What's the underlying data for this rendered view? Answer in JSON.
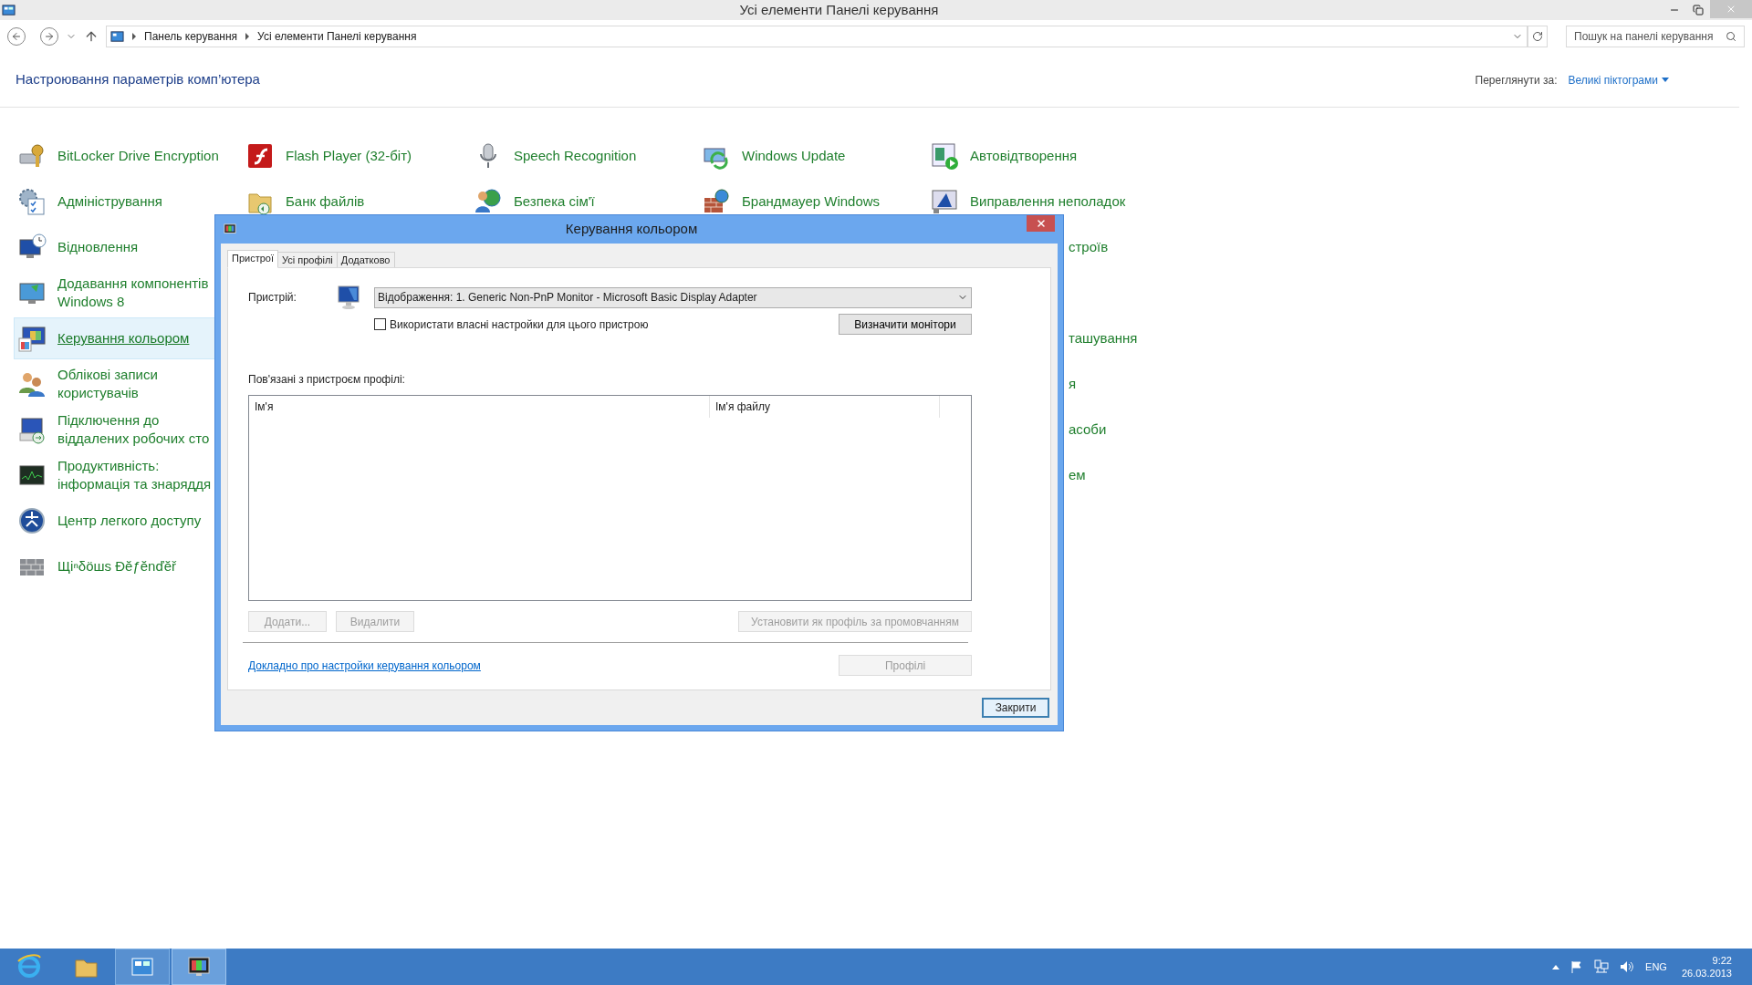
{
  "window": {
    "title": "Усі елементи Панелі керування"
  },
  "address_bar": {
    "breadcrumbs": [
      "Панель керування",
      "Усі елементи Панелі керування"
    ]
  },
  "search": {
    "placeholder": "Пошук на панелі керування"
  },
  "header": {
    "title": "Настроювання параметрів комп’ютера",
    "view_label": "Переглянути за:",
    "view_value": "Великі піктограми"
  },
  "columns": [
    {
      "items": [
        {
          "lines": [
            "BitLocker Drive Encryption"
          ],
          "selected": false
        },
        {
          "lines": [
            "Адміністрування"
          ],
          "selected": false
        },
        {
          "lines": [
            "Відновлення"
          ],
          "selected": false
        },
        {
          "lines": [
            "Додавання компонентів",
            "Windows 8"
          ],
          "selected": false
        },
        {
          "lines": [
            "Керування кольором"
          ],
          "selected": true
        },
        {
          "lines": [
            "Облікові записи",
            "користувачів"
          ],
          "selected": false
        },
        {
          "lines": [
            "Підключення до",
            "віддалених робочих сто"
          ],
          "selected": false
        },
        {
          "lines": [
            "Продуктивність:",
            "інформація та знаряддя"
          ],
          "selected": false
        },
        {
          "lines": [
            "Центр легкого доступу"
          ],
          "selected": false
        },
        {
          "lines": [
            "Щіⁿδöшs Đĕƒĕnďĕř"
          ],
          "selected": false
        }
      ]
    },
    {
      "items": [
        {
          "lines": [
            "Flash Player (32-біт)"
          ],
          "selected": false
        },
        {
          "lines": [
            "Банк файлів"
          ],
          "selected": false
        }
      ]
    },
    {
      "items": [
        {
          "lines": [
            "Speech Recognition"
          ],
          "selected": false
        },
        {
          "lines": [
            "Безпека сім'ї"
          ],
          "selected": false
        }
      ]
    },
    {
      "items": [
        {
          "lines": [
            "Windows Update"
          ],
          "selected": false
        },
        {
          "lines": [
            "Брандмауер Windows"
          ],
          "selected": false
        }
      ]
    },
    {
      "items": [
        {
          "lines": [
            "Автовідтворення"
          ],
          "selected": false
        },
        {
          "lines": [
            "Виправлення неполадок"
          ],
          "selected": false
        }
      ]
    }
  ],
  "hidden_column_fragments": [
    {
      "text": "строїв"
    },
    {
      "text": "ташування"
    },
    {
      "text": "я"
    },
    {
      "text": "асоби"
    },
    {
      "text": "ем"
    }
  ],
  "dialog": {
    "title": "Керування кольором",
    "tabs": [
      {
        "label": "Пристрої",
        "selected": true
      },
      {
        "label": "Усі профілі",
        "selected": false
      },
      {
        "label": "Додатково",
        "selected": false
      }
    ],
    "device_label": "Пристрій:",
    "device_value": "Відображення: 1. Generic Non-PnP Monitor - Microsoft Basic Display Adapter",
    "checkbox": {
      "label": "Використати власні настройки для цього пристрою",
      "checked": false
    },
    "identify_button": {
      "label": "Визначити монітори",
      "disabled": false
    },
    "profiles_label": "Пов'язані з пристроєм профілі:",
    "table": {
      "columns": [
        "Ім'я",
        "Ім'я файлу"
      ]
    },
    "action_buttons": [
      {
        "label": "Додати...",
        "disabled": true
      },
      {
        "label": "Видалити",
        "disabled": true
      },
      {
        "label": "Установити як профіль за промовчанням",
        "disabled": true
      }
    ],
    "link": "Докладно про настройки керування кольором",
    "profiles_button": {
      "label": "Профілі",
      "disabled": true
    },
    "close_button": {
      "label": "Закрити",
      "disabled": false
    }
  },
  "taskbar": {
    "apps": [
      {
        "selected": false
      },
      {
        "selected": false
      },
      {
        "selected": true
      },
      {
        "selected": true
      }
    ],
    "language": "ENG",
    "time": "9:22",
    "date": "26.03.2013"
  }
}
